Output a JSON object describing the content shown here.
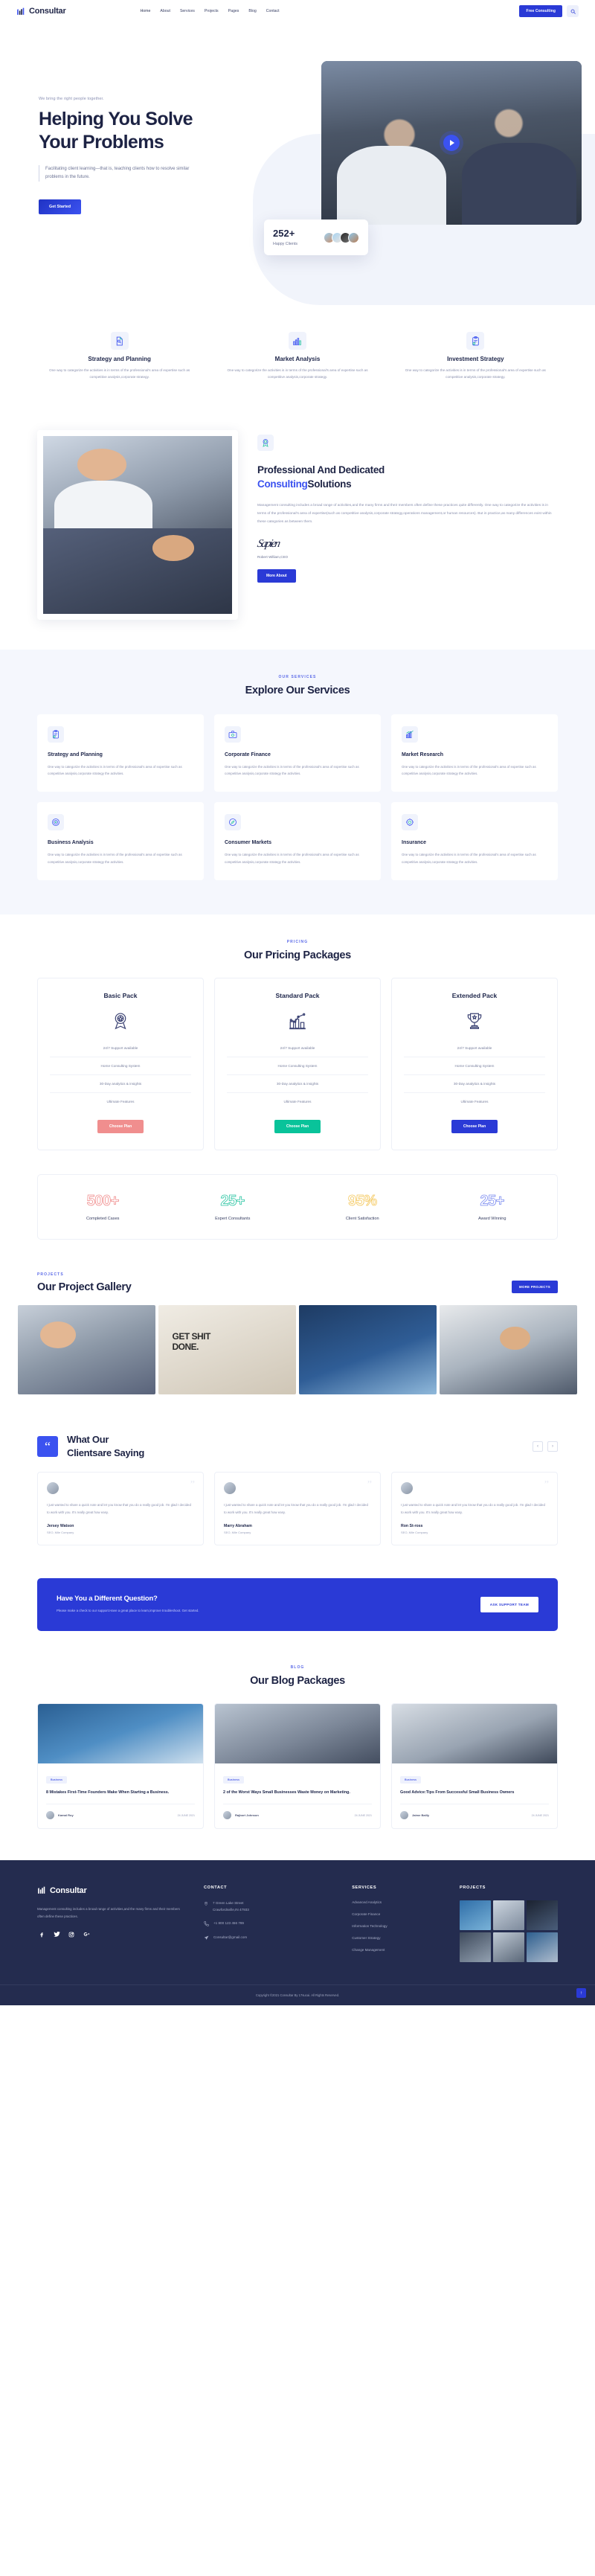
{
  "brand": {
    "name": "Consultar",
    "logo_icon": "bar-chart-logo-icon"
  },
  "header": {
    "nav": [
      {
        "label": "Home",
        "active": true
      },
      {
        "label": "About",
        "active": false
      },
      {
        "label": "Services",
        "active": false
      },
      {
        "label": "Projects",
        "active": false
      },
      {
        "label": "Pages",
        "active": false
      },
      {
        "label": "Blog",
        "active": false
      },
      {
        "label": "Contact",
        "active": false
      }
    ],
    "cta_label": "Free Consulting",
    "search_icon": "search-icon"
  },
  "hero": {
    "eyebrow": "We bring the right people together.",
    "title_line1": "Helping You Solve",
    "title_line2": "Your Problems",
    "subtitle": "Facilitating client learning—that is, teaching clients how to resolve similar problems in the future.",
    "cta_label": "Get Started",
    "play_icon": "play-icon",
    "clients_number": "252+",
    "clients_label": "Happy Clients"
  },
  "features": [
    {
      "icon": "document-search-icon",
      "title": "Strategy and Planning",
      "desc": "One way to categorize the activities is in terms of the professional's area of expertise such as competitive analysis,corporate strategy."
    },
    {
      "icon": "bar-chart-growth-icon",
      "title": "Market Analysis",
      "desc": "One way to categorize the activities is in terms of the professional's area of expertise such as competitive analysis,corporate strategy."
    },
    {
      "icon": "clipboard-edit-icon",
      "title": "Investment Strategy",
      "desc": "One way to categorize the activities is in terms of the professional's area of expertise such as competitive analysis,corporate strategy."
    }
  ],
  "about": {
    "icon": "badge-icon",
    "title_line1": "Professional And Dedicated",
    "title_accent": "Consulting",
    "title_rest": "Solutions",
    "paragraph": "Management consulting includes a broad range of activities,and the many firms and their members often define these practices quite differently. One way to categorize the activities is in terms of the professional's area of expertise(such as competitive analysis,corporate strategy,operations management,or human resources). But in practice,as many differences exist within these categories as between them.",
    "signature": "Sapien",
    "signature_name": "Robert William,CEO",
    "cta_label": "More About"
  },
  "services": {
    "eyebrow": "OUR SERVICES",
    "title": "Explore Our Services",
    "cards": [
      {
        "icon": "clipboard-edit-icon",
        "title": "Strategy and Planning",
        "desc": "One way to categorize the activities is in terms of the professional's area of expertise such as competitive analysis,corporate strategy the activities."
      },
      {
        "icon": "briefcase-icon",
        "title": "Corporate Finance",
        "desc": "One way to categorize the activities is in terms of the professional's area of expertise such as competitive analysis,corporate strategy the activities."
      },
      {
        "icon": "bar-chart-growth-icon",
        "title": "Market Research",
        "desc": "One way to categorize the activities is in terms of the professional's area of expertise such as competitive analysis,corporate strategy the activities."
      },
      {
        "icon": "target-analysis-icon",
        "title": "Business Analysis",
        "desc": "One way to categorize the activities is in terms of the professional's area of expertise such as competitive analysis,corporate strategy the activities."
      },
      {
        "icon": "compass-icon",
        "title": "Consumer Markets",
        "desc": "One way to categorize the activities is in terms of the professional's area of expertise such as competitive analysis,corporate strategy the activities."
      },
      {
        "icon": "shield-gear-icon",
        "title": "Insurance",
        "desc": "One way to categorize the activities is in terms of the professional's area of expertise such as competitive analysis,corporate strategy the activities."
      }
    ]
  },
  "pricing": {
    "eyebrow": "PRICING",
    "title": "Our Pricing Packages",
    "features": [
      "24/7 Support available",
      "Home Consulting System",
      "30-Day analytics & insights",
      "Ultimate Features"
    ],
    "plans": [
      {
        "name": "Basic Pack",
        "icon": "ribbon-award-icon",
        "button": "Choose Plan",
        "color": "#f08e8e"
      },
      {
        "name": "Standard Pack",
        "icon": "chart-bars-icon",
        "button": "Choose Plan",
        "color": "#09c39a"
      },
      {
        "name": "Extended Pack",
        "icon": "trophy-icon",
        "button": "Choose Plan",
        "color": "#2a3ad6"
      }
    ]
  },
  "counters": [
    {
      "value": "500+",
      "label": "Completed Cases",
      "color": "#f08e8e"
    },
    {
      "value": "25+",
      "label": "Expert Consultants",
      "color": "#2fc6a4"
    },
    {
      "value": "95%",
      "label": "Client Satisfaction",
      "color": "#f4c75b"
    },
    {
      "value": "25+",
      "label": "Award Winning",
      "color": "#7d8df0"
    }
  ],
  "projects": {
    "eyebrow": "PROJECTS",
    "title": "Our Project Gallery",
    "cta_label": "MORE PROJECTS",
    "items": [
      {
        "name": "project-handshake-office"
      },
      {
        "name": "project-get-shit-done",
        "overlay_text_line1": "GET SHIT",
        "overlay_text_line2": "DONE."
      },
      {
        "name": "project-handshake-skyline"
      },
      {
        "name": "project-desk-consultant"
      }
    ]
  },
  "testimonials": {
    "quote_icon": "quote-icon",
    "title_line1": "What Our",
    "title_line2": "Clientsare Saying",
    "prev_icon": "chevron-left-icon",
    "next_icon": "chevron-right-icon",
    "cards": [
      {
        "text": "I just wanted to share a quick note and let you know that you do a really good job. I'm glad I decided to work with you. It's really great how easy.",
        "name": "Jersey Watson",
        "role": "SEO, Mile Company"
      },
      {
        "text": "I just wanted to share a quick note and let you know that you do a really good job. I'm glad I decided to work with you. It's really great how easy.",
        "name": "Marry Abraham",
        "role": "SEO, Mile Company"
      },
      {
        "text": "I just wanted to share a quick note and let you know that you do a really good job. I'm glad I decided to work with you. It's really great how easy.",
        "name": "Ron St-ross",
        "role": "SEO, Mile Company"
      }
    ]
  },
  "cta": {
    "title": "Have You a Different Question?",
    "desc": "Please make a check to our support.Have a great place to learn,improve troubleshoot. Get started.",
    "button": "ASK SUPPORT TEAM"
  },
  "blog": {
    "eyebrow": "BLOG",
    "title": "Our Blog Packages",
    "posts": [
      {
        "tag": "Business",
        "title": "8 Mistakes First-Time Founders Make When Starting a Business.",
        "author": "Kamal Roy",
        "date": "24 JUNE 2021",
        "image": "handshake-blue-photo"
      },
      {
        "tag": "Business",
        "title": "2 of the Worst Ways Small Businesses Waste Money on Marketing.",
        "author": "Rajbort Johnson",
        "date": "24 JUNE 2021",
        "image": "team-meeting-photo"
      },
      {
        "tag": "Business",
        "title": "Good Advice:Tips From Successful Small Business Owners",
        "author": "Jaime Bailly",
        "date": "24 JUNE 2021",
        "image": "office-handshake-photo"
      }
    ]
  },
  "footer": {
    "desc": "Management consulting includes a broad range of activities,and the many firms and their members often define these practices.",
    "social": [
      {
        "icon": "facebook-icon",
        "glyph": "f"
      },
      {
        "icon": "twitter-icon",
        "glyph": "✦"
      },
      {
        "icon": "instagram-icon",
        "glyph": "▣"
      },
      {
        "icon": "google-plus-icon",
        "glyph": "g⁺"
      }
    ],
    "contact": {
      "heading": "CONTACT",
      "address_line1": "7 Green Lake Street",
      "address_line2": "Crawfordsville,IN 47933",
      "phone": "+1 800 123 456 789",
      "email": "Consultar@gmail.com",
      "location_icon": "location-pin-icon",
      "phone_icon": "phone-icon",
      "email_icon": "paper-plane-icon"
    },
    "services": {
      "heading": "SERVICES",
      "links": [
        "Advanced Analytics",
        "Corporate Finance",
        "Information Technology",
        "Customer Strategy",
        "Change Management"
      ]
    },
    "projects_heading": "PROJECTS",
    "copyright": "Copyright ©2021 Consultar By 17sucai. All Rights Reserved.",
    "scroll_top_icon": "chevron-up-icon"
  }
}
